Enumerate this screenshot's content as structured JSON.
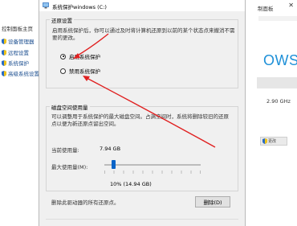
{
  "background_left": {
    "control_panel_home": "控制面板主页",
    "nav_items": [
      "设备管理器",
      "远程设置",
      "系统保护",
      "高级系统设置"
    ]
  },
  "background_right": {
    "title_fragment": "制面板",
    "windows_text": "OWS",
    "cpu_speed": "2.90 GHz",
    "button_fragment": "更改"
  },
  "dialog": {
    "title": "系统保护windows (C:)",
    "restore_settings": {
      "legend": "还原设置",
      "description": "启用系统保护后，你可以通过及时将计算机还原到以前的某个状态点来撤消不需要的更改。",
      "options": [
        {
          "label": "启用系统保护",
          "selected": true
        },
        {
          "label": "禁用系统保护",
          "selected": false
        }
      ]
    },
    "disk_usage": {
      "legend": "磁盘空间使用量",
      "description": "可以调整用于系统保护的最大磁盘空间。占满空间时，系统将删除较旧的还原点以便为新还原点留出空间。",
      "current_usage_label": "当前使用量:",
      "current_usage_value": "7.94 GB",
      "max_usage_label": "最大使用量(M):",
      "slider_fraction": 0.1,
      "max_usage_value": "10% (14.94 GB)",
      "delete_text": "删除此驱动器的所有还原点。",
      "delete_button": "删除(D)"
    }
  },
  "colors": {
    "accent": "#0a64c8",
    "annotation": "#e02020",
    "windows_blue": "#1e90d8"
  }
}
